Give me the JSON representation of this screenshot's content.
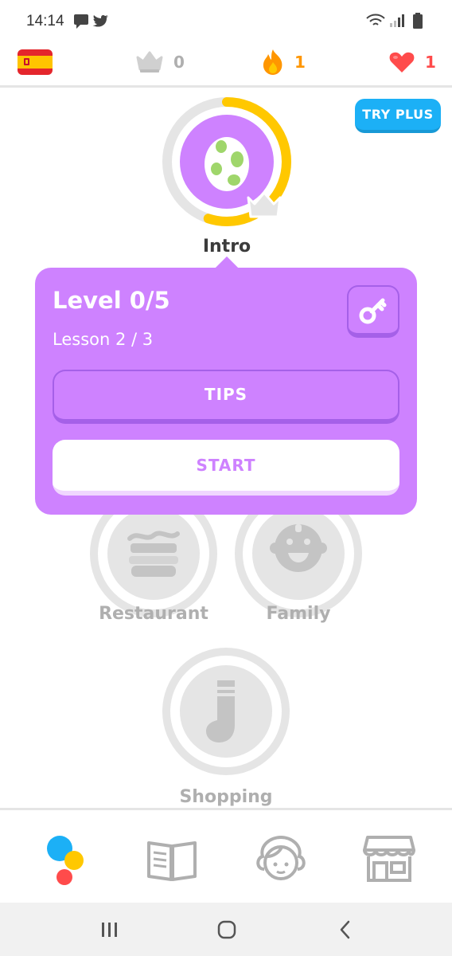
{
  "status_bar": {
    "time": "14:14"
  },
  "stats": {
    "crowns": "0",
    "streak": "1",
    "hearts": "1"
  },
  "try_plus": {
    "label": "TRY PLUS"
  },
  "skills": {
    "intro": {
      "label": "Intro",
      "progress": 0.55
    },
    "restaurant": {
      "label": "Restaurant"
    },
    "family": {
      "label": "Family"
    },
    "shopping": {
      "label": "Shopping"
    }
  },
  "popup": {
    "level": "Level 0/5",
    "lesson": "Lesson 2 / 3",
    "tips_label": "TIPS",
    "start_label": "START"
  },
  "colors": {
    "purple": "#ce82ff",
    "blue": "#1cb0f6",
    "gold": "#ffc800",
    "streak_orange": "#ff9600",
    "heart_red": "#ff4b4b",
    "grey": "#afafaf"
  },
  "icons": {
    "status": [
      "message-icon",
      "twitter-icon",
      "wifi-icon",
      "signal-icon",
      "battery-icon"
    ],
    "nav": [
      "learn-icon",
      "stories-icon",
      "profile-icon",
      "shop-icon"
    ]
  }
}
